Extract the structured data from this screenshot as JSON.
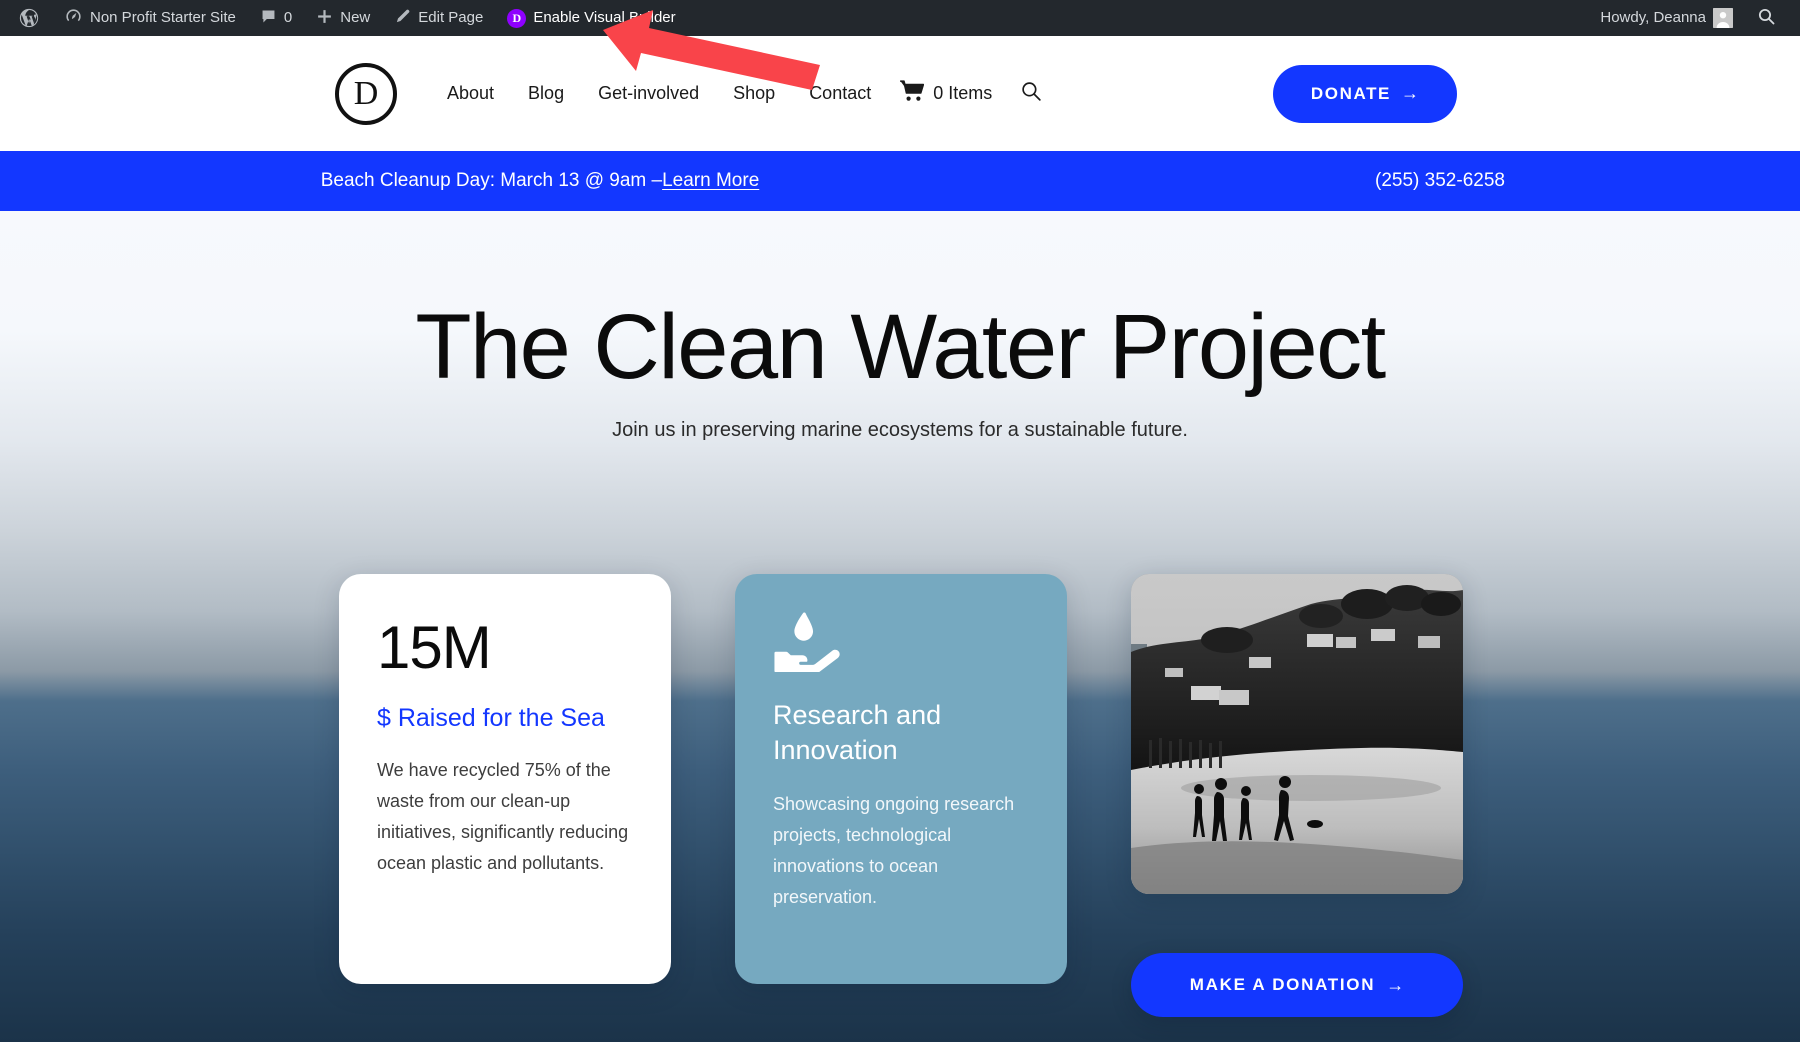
{
  "admin_bar": {
    "wp_logo": "wordpress-logo-icon",
    "site_name": "Non Profit Starter Site",
    "comments_count": "0",
    "new_label": "New",
    "edit_page_label": "Edit Page",
    "divi_badge": "D",
    "visual_builder_label": "Enable Visual Builder",
    "howdy": "Howdy, Deanna",
    "search_icon": "search-icon",
    "bar_bg": "#23282d",
    "divi_badge_color": "#8f00ff"
  },
  "header": {
    "logo_letter": "D",
    "nav": [
      {
        "label": "About"
      },
      {
        "label": "Blog"
      },
      {
        "label": "Get-involved"
      },
      {
        "label": "Shop"
      },
      {
        "label": "Contact"
      }
    ],
    "cart_label": "0 Items",
    "cart_icon": "shopping-cart-icon",
    "search_icon": "search-icon",
    "donate_label": "DONATE",
    "donate_arrow": "→",
    "accent_blue": "#1337ff"
  },
  "announcement": {
    "text_prefix": "Beach Cleanup Day: March 13 @ 9am – ",
    "link_label": "Learn More",
    "phone": "(255) 352-6258",
    "bg": "#1337ff"
  },
  "hero": {
    "title": "The Clean Water Project",
    "subtitle": "Join us in preserving marine ecosystems for a sustainable future."
  },
  "cards": {
    "stat": {
      "number": "15M",
      "label": "$ Raised for the Sea",
      "body": "We have recycled 75% of the waste from our clean-up initiatives, significantly reducing ocean plastic and pollutants.",
      "label_color": "#1337ff"
    },
    "feature": {
      "icon": "hand-holding-water-drop-icon",
      "title": "Research and Innovation",
      "body": "Showcasing ongoing research projects, technological innovations to ocean preservation.",
      "bg": "#76a9c0"
    },
    "media": {
      "photo_alt": "grayscale-beach-hillside-photo",
      "cta_label": "MAKE A DONATION",
      "cta_arrow": "→",
      "cta_bg": "#1337ff"
    }
  },
  "annotation": {
    "arrow": "red-arrow-pointing-to-enable-visual-builder",
    "color": "#f9444a"
  }
}
